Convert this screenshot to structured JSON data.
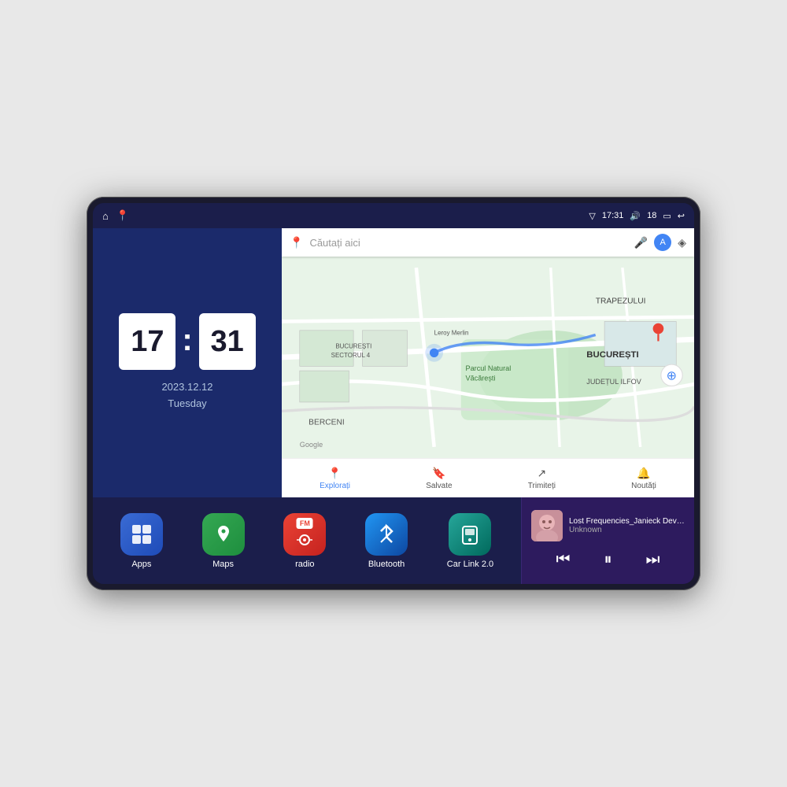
{
  "device": {
    "status_bar": {
      "left_icons": [
        "home",
        "maps"
      ],
      "time": "17:31",
      "signal": "▽",
      "volume": "🔊",
      "battery_level": "18",
      "battery_icon": "🔋",
      "back": "↩"
    },
    "clock": {
      "hour": "17",
      "minute": "31",
      "date": "2023.12.12",
      "day": "Tuesday"
    },
    "map": {
      "search_placeholder": "Căutați aici",
      "footer_items": [
        {
          "icon": "📍",
          "label": "Explorați",
          "active": true
        },
        {
          "icon": "🔖",
          "label": "Salvate",
          "active": false
        },
        {
          "icon": "↗",
          "label": "Trimiteți",
          "active": false
        },
        {
          "icon": "🔔",
          "label": "Noutăți",
          "active": false
        }
      ],
      "location_labels": [
        "TRAPEZULUI",
        "BUCUREȘTI",
        "JUDEȚUL ILFOV",
        "BERCENI",
        "BUCUREȘTI SECTORUL 4",
        "Parcul Natural Văcărești",
        "Leroy Merlin"
      ],
      "google_logo": "Google"
    },
    "apps": [
      {
        "id": "apps",
        "label": "Apps",
        "icon": "⊞",
        "bg_class": "bg-apps"
      },
      {
        "id": "maps",
        "label": "Maps",
        "icon": "📍",
        "bg_class": "bg-maps"
      },
      {
        "id": "radio",
        "label": "radio",
        "icon": "📻",
        "bg_class": "bg-radio"
      },
      {
        "id": "bluetooth",
        "label": "Bluetooth",
        "icon": "⬡",
        "bg_class": "bg-bt"
      },
      {
        "id": "carlink",
        "label": "Car Link 2.0",
        "icon": "📱",
        "bg_class": "bg-carlink"
      }
    ],
    "music": {
      "title": "Lost Frequencies_Janieck Devy-...",
      "artist": "Unknown",
      "controls": {
        "prev": "⏮",
        "play_pause": "⏸",
        "next": "⏭"
      }
    }
  }
}
